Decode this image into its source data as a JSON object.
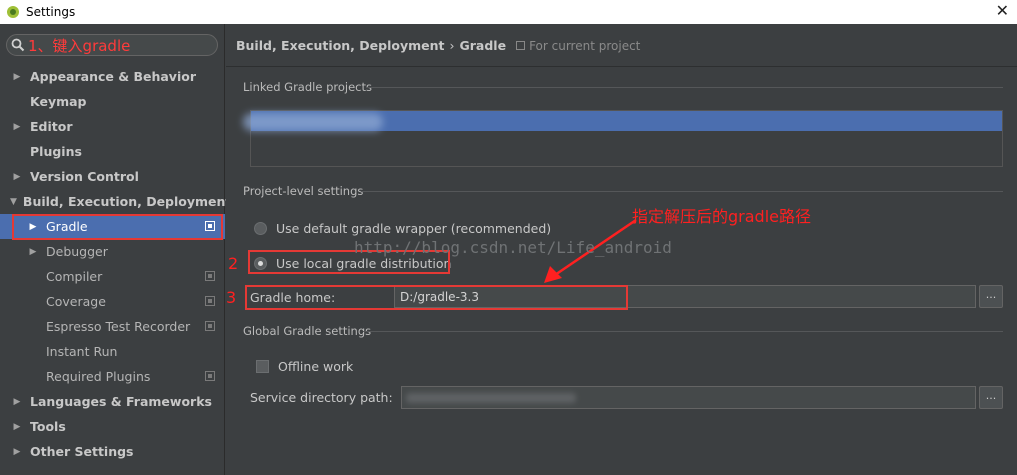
{
  "window": {
    "title": "Settings"
  },
  "search": {
    "value": "1、键入gradle"
  },
  "sidebar": {
    "items": [
      {
        "label": "Appearance & Behavior",
        "expanded": false
      },
      {
        "label": "Keymap"
      },
      {
        "label": "Editor",
        "expanded": false
      },
      {
        "label": "Plugins"
      },
      {
        "label": "Version Control",
        "expanded": false
      },
      {
        "label": "Build, Execution, Deployment",
        "expanded": true
      },
      {
        "label": "Gradle",
        "selected": true
      },
      {
        "label": "Debugger"
      },
      {
        "label": "Compiler"
      },
      {
        "label": "Coverage"
      },
      {
        "label": "Espresso Test Recorder"
      },
      {
        "label": "Instant Run"
      },
      {
        "label": "Required Plugins"
      },
      {
        "label": "Languages & Frameworks",
        "expanded": false
      },
      {
        "label": "Tools",
        "expanded": false
      },
      {
        "label": "Other Settings",
        "expanded": false
      }
    ]
  },
  "breadcrumb": {
    "parent": "Build, Execution, Deployment",
    "separator": "›",
    "current": "Gradle",
    "scope": "For current project"
  },
  "sections": {
    "linked": "Linked Gradle projects",
    "project_level": "Project-level settings",
    "global": "Global Gradle settings"
  },
  "options": {
    "default_wrapper": "Use default gradle wrapper (recommended)",
    "local_distribution": "Use local gradle distribution"
  },
  "gradle_home": {
    "label": "Gradle home:",
    "value": "D:/gradle-3.3"
  },
  "offline": {
    "label": "Offline work"
  },
  "service_dir": {
    "label": "Service directory path:"
  },
  "buttons": {
    "browse": "..."
  },
  "annotations": {
    "step2": "2",
    "step3": "3",
    "hint": "指定解压后的gradle路径",
    "watermark": "http://blog.csdn.net/Life_android"
  },
  "colors": {
    "selection": "#4b6eaf",
    "annotation": "#e53935"
  }
}
